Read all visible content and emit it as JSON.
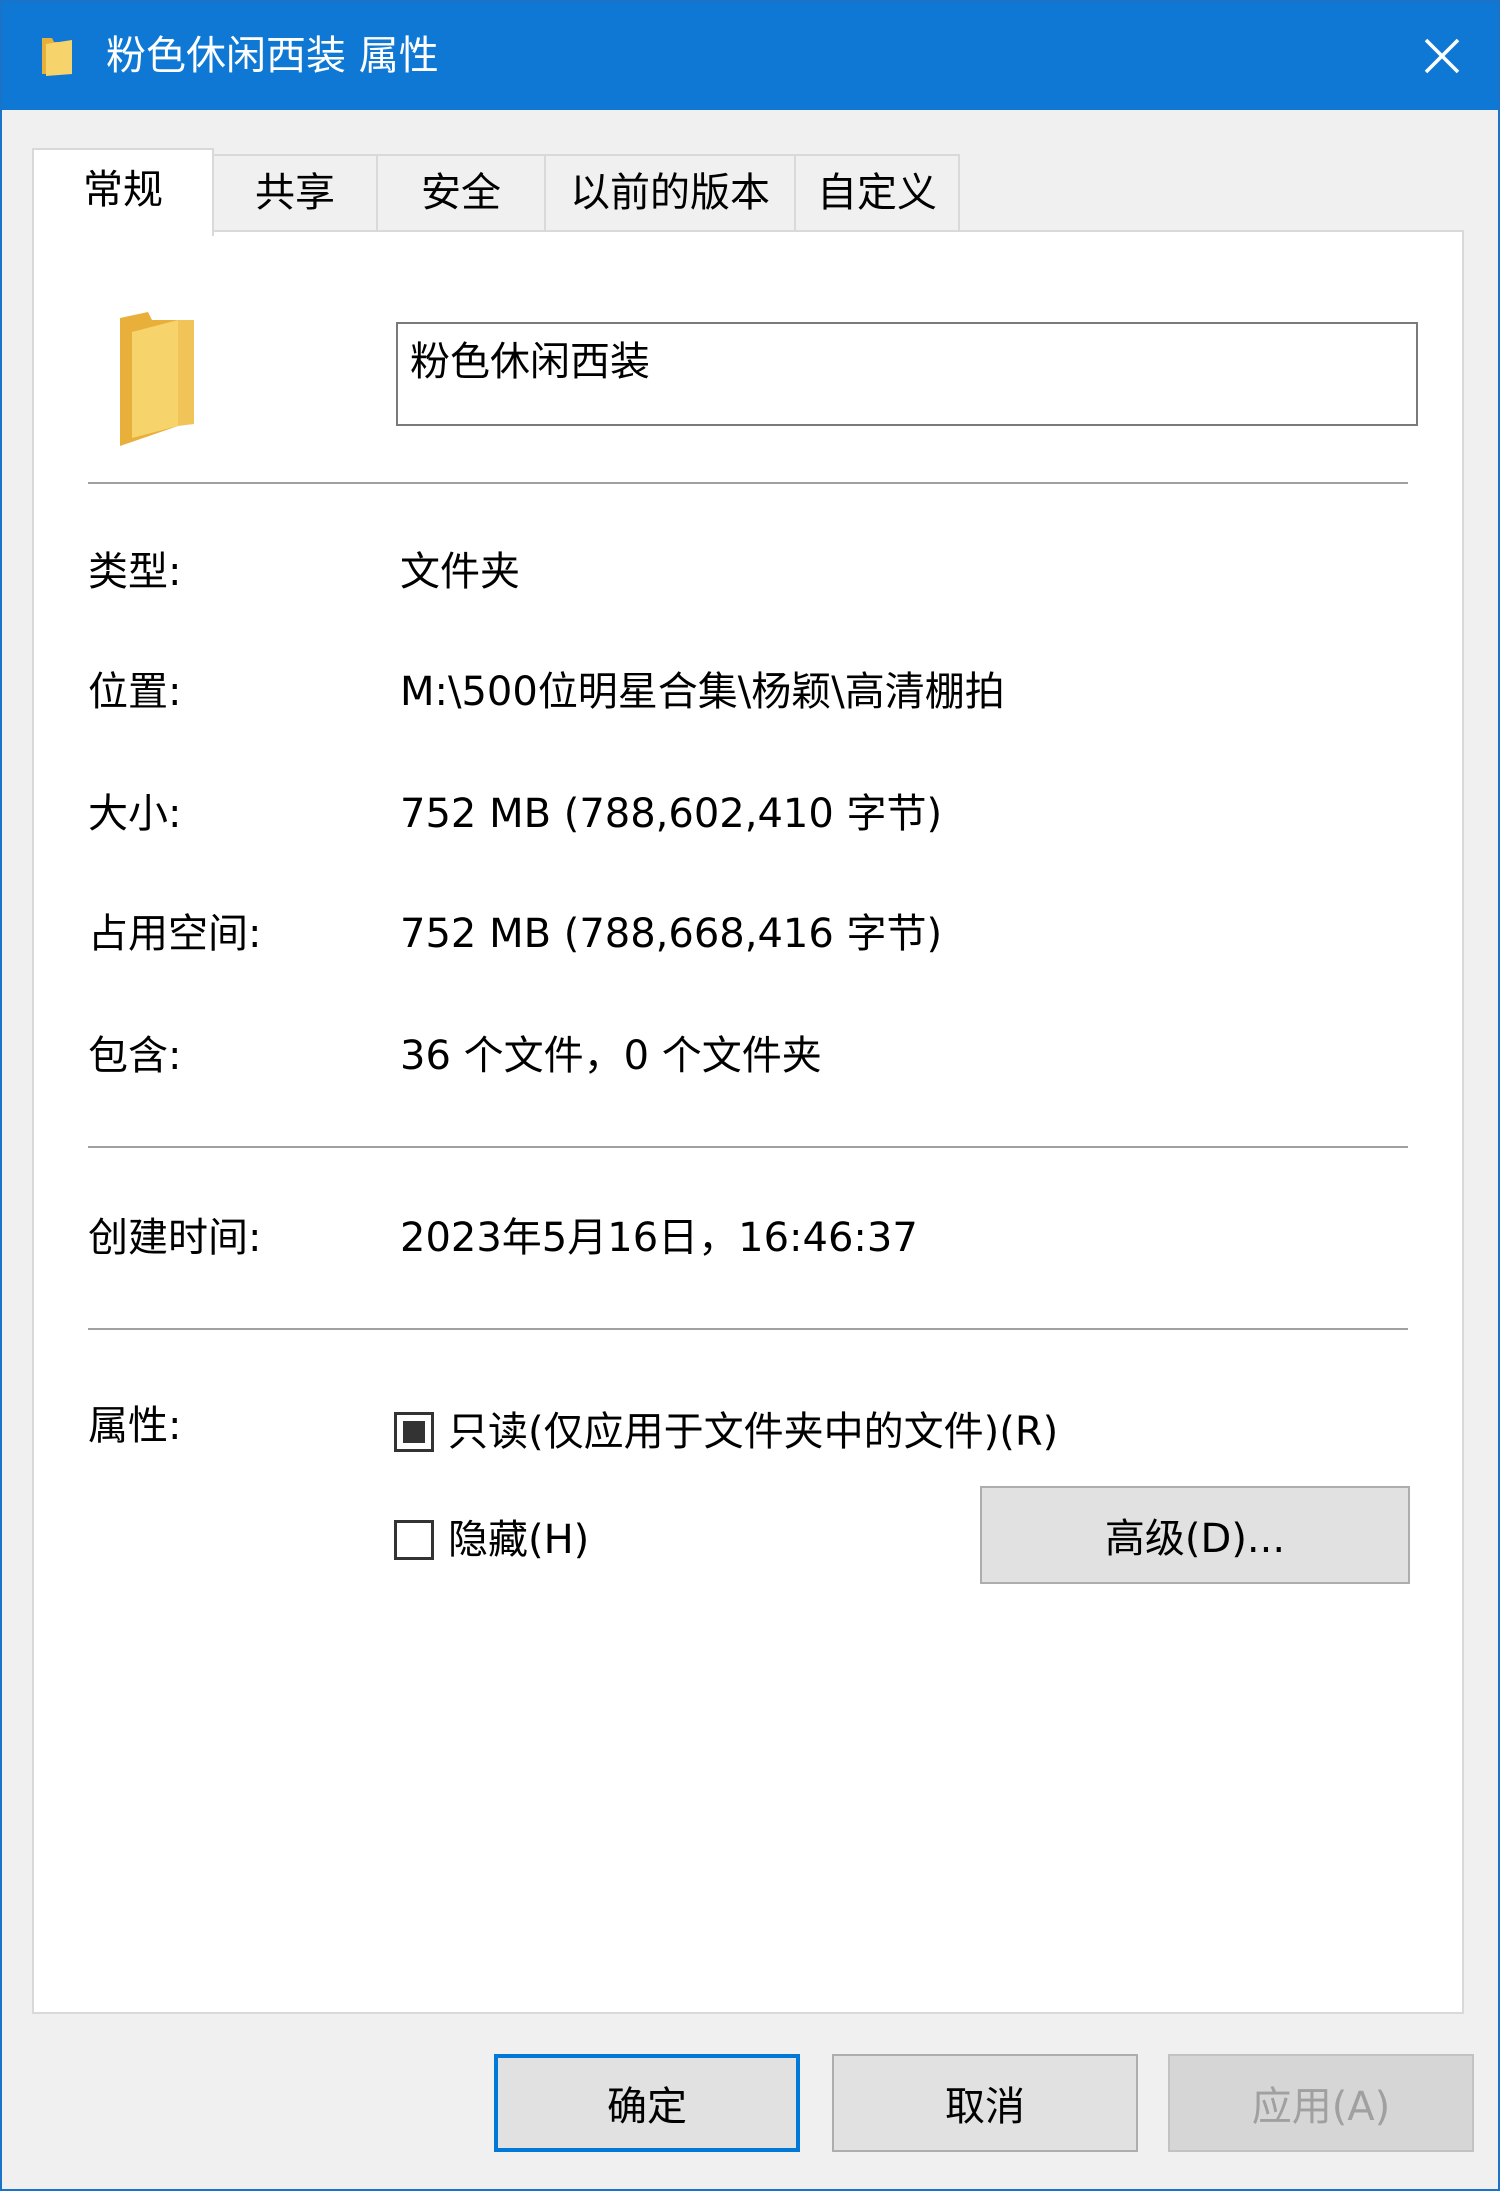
{
  "window": {
    "title": "粉色休闲西装 属性"
  },
  "tabs": [
    {
      "label": "常规",
      "active": true
    },
    {
      "label": "共享",
      "active": false
    },
    {
      "label": "安全",
      "active": false
    },
    {
      "label": "以前的版本",
      "active": false
    },
    {
      "label": "自定义",
      "active": false
    }
  ],
  "general": {
    "name": "粉色休闲西装",
    "type_label": "类型:",
    "type_value": "文件夹",
    "location_label": "位置:",
    "location_value": "M:\\500位明星合集\\杨颖\\高清棚拍",
    "size_label": "大小:",
    "size_value": "752 MB (788,602,410 字节)",
    "disk_size_label": "占用空间:",
    "disk_size_value": "752 MB (788,668,416 字节)",
    "contains_label": "包含:",
    "contains_value": "36 个文件，0 个文件夹",
    "created_label": "创建时间:",
    "created_value": "2023年5月16日，16:46:37",
    "attributes_label": "属性:",
    "readonly_label": "只读(仅应用于文件夹中的文件)(R)",
    "readonly_state": "indeterminate",
    "hidden_label": "隐藏(H)",
    "hidden_state": "unchecked",
    "advanced_button": "高级(D)..."
  },
  "buttons": {
    "ok": "确定",
    "cancel": "取消",
    "apply": "应用(A)"
  },
  "colors": {
    "titlebar": "#0f78d4",
    "folder": "#f4c95d",
    "default_button_border": "#0078d7"
  },
  "icons": {
    "title": "folder-icon",
    "close": "close-icon",
    "main": "folder-icon"
  }
}
